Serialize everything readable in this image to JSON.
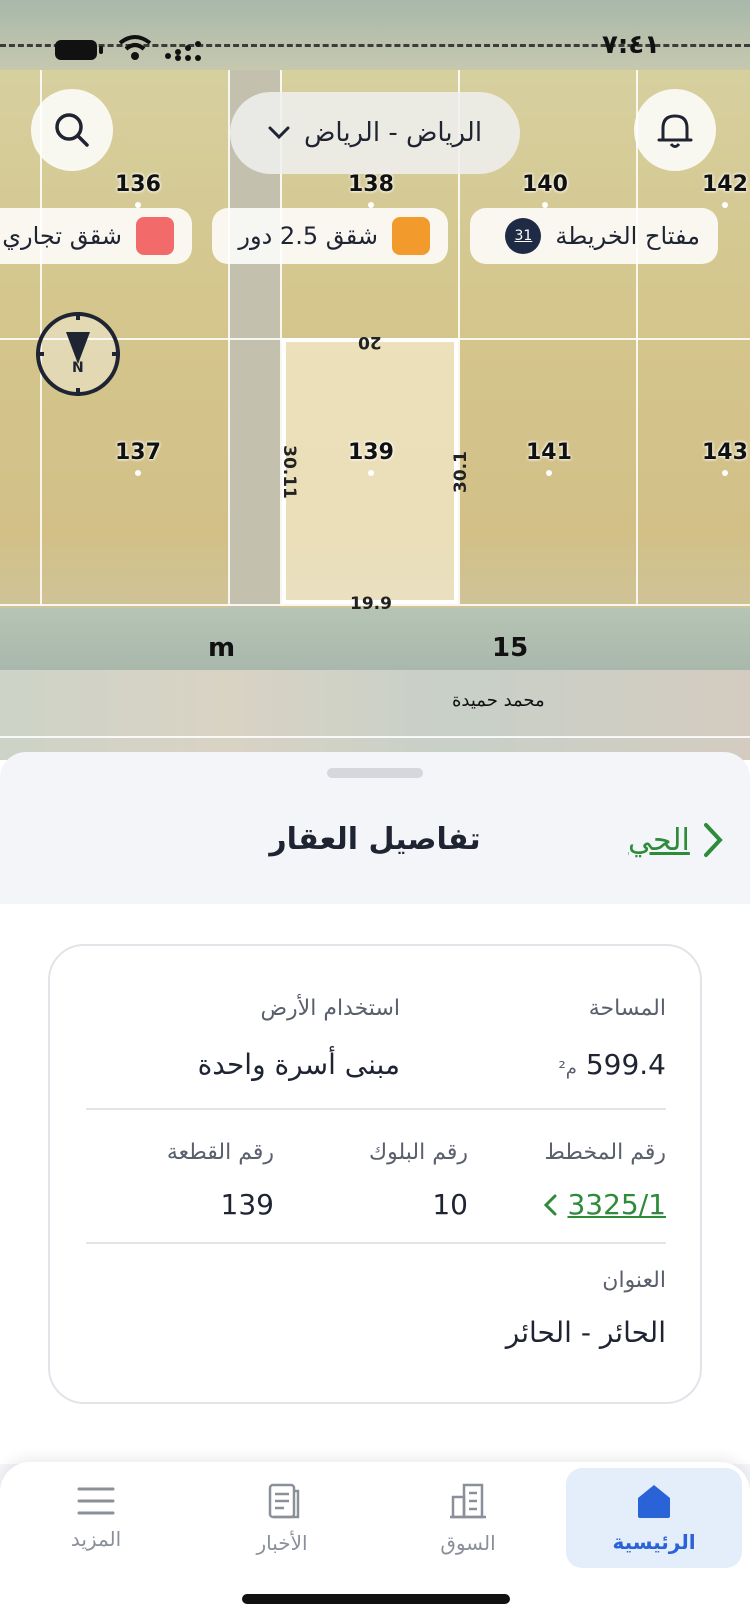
{
  "status_bar": {
    "time": "٧:٤١"
  },
  "map": {
    "city_selector": "الرياض - الرياض",
    "legend_chips": [
      {
        "label": "مفتاح الخريطة",
        "badge": "31"
      },
      {
        "label": "شقق 2.5 دور",
        "color": "#f39a2c"
      },
      {
        "label": "شقق تجاري",
        "color": "#f26a6a"
      }
    ],
    "lot_numbers": {
      "l136": "136",
      "l138": "138",
      "l140": "140",
      "l142": "142",
      "l137": "137",
      "l139": "139",
      "l141": "141",
      "l143": "143"
    },
    "dimensions": {
      "top": "20",
      "left": "30.11",
      "right": "30.1",
      "bottom": "19.9"
    },
    "street_labels": {
      "m": "m",
      "n15": "15"
    },
    "place_label": "محمد حميدة",
    "compass_letter": "N"
  },
  "sheet": {
    "title": "تفاصيل العقار",
    "neighborhood_link": "الحي",
    "area_label": "المساحة",
    "area_value": "599.4",
    "area_unit": "م²",
    "land_use_label": "استخدام الأرض",
    "land_use_value": "مبنى أسرة واحدة",
    "plan_label": "رقم المخطط",
    "plan_value": "3325/1",
    "block_label": "رقم البلوك",
    "block_value": "10",
    "plot_label": "رقم القطعة",
    "plot_value": "139",
    "address_label": "العنوان",
    "address_value": "الحائر - الحائر"
  },
  "tabs": [
    {
      "label": "الرئيسية",
      "icon": "home-icon",
      "active": true
    },
    {
      "label": "السوق",
      "icon": "buildings-icon",
      "active": false
    },
    {
      "label": "الأخبار",
      "icon": "news-icon",
      "active": false
    },
    {
      "label": "المزيد",
      "icon": "menu-icon",
      "active": false
    }
  ],
  "colors": {
    "accent_green": "#2e8b3a",
    "tab_active": "#2a62d8",
    "badge_dark": "#1f2a44"
  }
}
